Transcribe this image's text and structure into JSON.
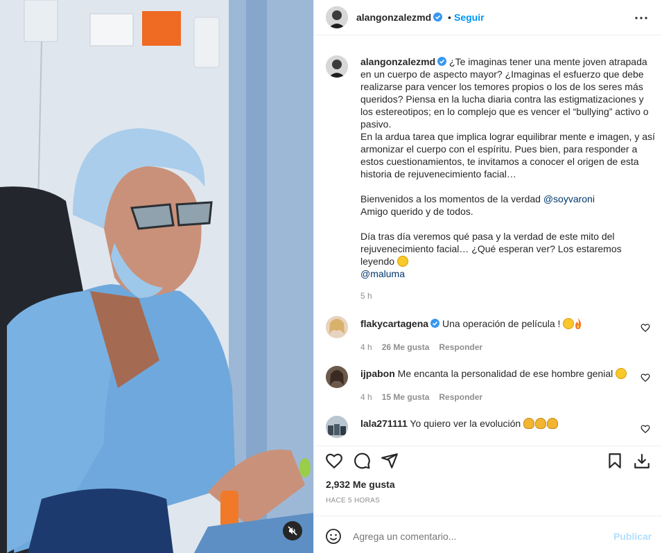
{
  "header": {
    "username": "alangonzalezmd",
    "dot": "•",
    "follow_label": "Seguir"
  },
  "caption": {
    "username": "alangonzalezmd",
    "p1": "¿Te imaginas tener una mente joven atrapada en un cuerpo de aspecto mayor? ¿Imaginas el esfuerzo que debe realizarse para vencer los temores propios o los de los seres más queridos? Piensa en la lucha diaria contra las estigmatizaciones y los estereotipos; en lo complejo que es vencer el “bullying” activo o pasivo.",
    "p2": "En la ardua tarea que implica lograr equilibrar mente e imagen, y así armonizar el cuerpo con el espíritu. Pues bien, para responder a estos cuestionamientos, te invitamos a conocer el origen de esta historia de rejuvenecimiento facial…",
    "p3_text": "Bienvenidos a los momentos de la verdad ",
    "p3_mention": "@soyvaroni",
    "p4": "Amigo querido y de todos.",
    "p5": "Día tras día veremos qué pasa y la verdad de este mito del rejuvenecimiento facial… ¿Qué esperan ver? Los estaremos leyendo",
    "p6_mention": "@maluma",
    "time": "5 h"
  },
  "comments": [
    {
      "username": "flakycartagena",
      "text": "Una operación de película !",
      "time": "4 h",
      "likes": "26 Me gusta",
      "reply": "Responder"
    },
    {
      "username": "ijpabon",
      "text": "Me encanta la personalidad de ese hombre genial",
      "time": "4 h",
      "likes": "15 Me gusta",
      "reply": "Responder"
    },
    {
      "username": "lala271111",
      "text": "Yo quiero ver la evolución"
    }
  ],
  "likes_count": "2,932 Me gusta",
  "posted_ago": "HACE 5 HORAS",
  "comment_box": {
    "placeholder": "Agrega un comentario...",
    "publish_label": "Publicar"
  },
  "icons": {
    "more": "more-options-icon",
    "heart": "heart-icon",
    "comment": "comment-icon",
    "share": "share-icon",
    "save": "bookmark-icon",
    "download": "download-icon",
    "emoji": "emoji-icon",
    "mute": "muted-speaker-icon",
    "verified": "verified-badge-icon"
  },
  "colors": {
    "accent": "#0095f6",
    "publish_disabled": "#b2dffc",
    "mention": "#00376b",
    "muted_text": "#8e8e8e"
  }
}
